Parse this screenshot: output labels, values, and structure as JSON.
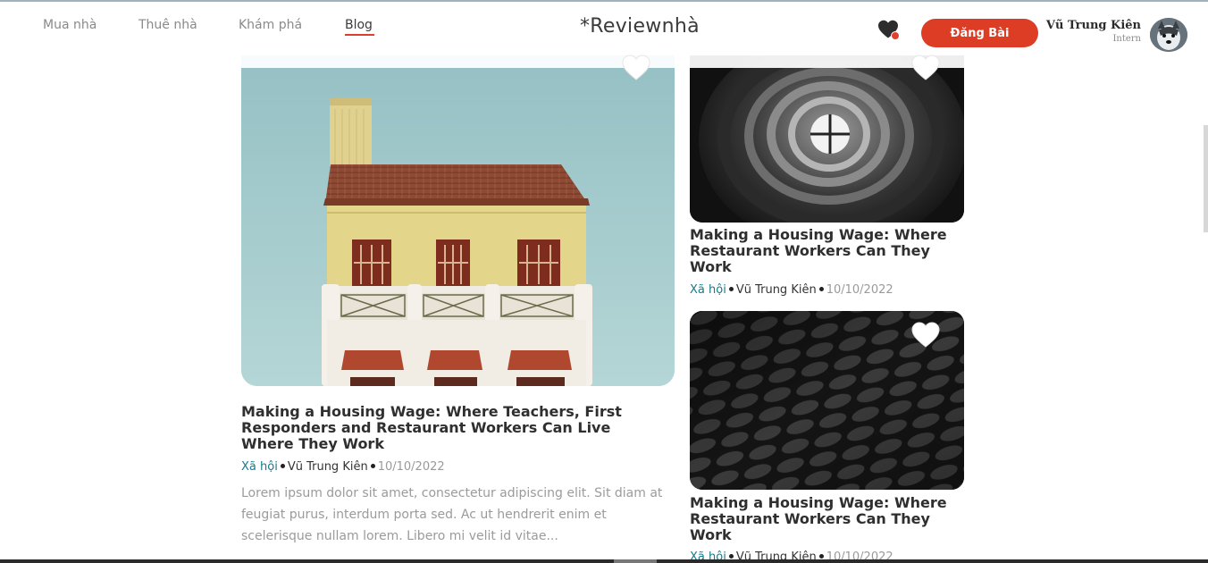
{
  "nav": {
    "items": [
      {
        "label": "Mua nhà"
      },
      {
        "label": "Thuê nhà"
      },
      {
        "label": "Khám phá"
      },
      {
        "label": "Blog"
      }
    ],
    "active_index": 3
  },
  "logo": {
    "text": "*Reviewnhà"
  },
  "header": {
    "post_button": "Đăng Bài",
    "user": {
      "name": "Vũ Trung Kiên",
      "role": "Intern"
    },
    "accent_color": "#dc3d24"
  },
  "posts": [
    {
      "title": "Making a Housing Wage: Where Teachers, First Responders and Restaurant Workers Can Live Where They Work",
      "category": "Xã hội",
      "author": "Vũ Trung Kiên",
      "date": "10/10/2022",
      "excerpt": "Lorem ipsum dolor sit amet, consectetur adipiscing elit. Sit diam at feugiat purus, interdum porta sed. Ac ut hendrerit enim et scelerisque nullam lorem. Libero mi velit id vitae..."
    },
    {
      "title": "Making a Housing Wage: Where Restaurant Workers Can They Work",
      "category": "Xã hội",
      "author": "Vũ Trung Kiên",
      "date": "10/10/2022"
    },
    {
      "title": "Making a Housing Wage: Where Restaurant Workers Can They Work",
      "category": "Xã hội",
      "author": "Vũ Trung Kiên",
      "date": "10/10/2022"
    }
  ],
  "colors": {
    "category": "#137c8b",
    "hero_sky": "#9cc3c6"
  }
}
